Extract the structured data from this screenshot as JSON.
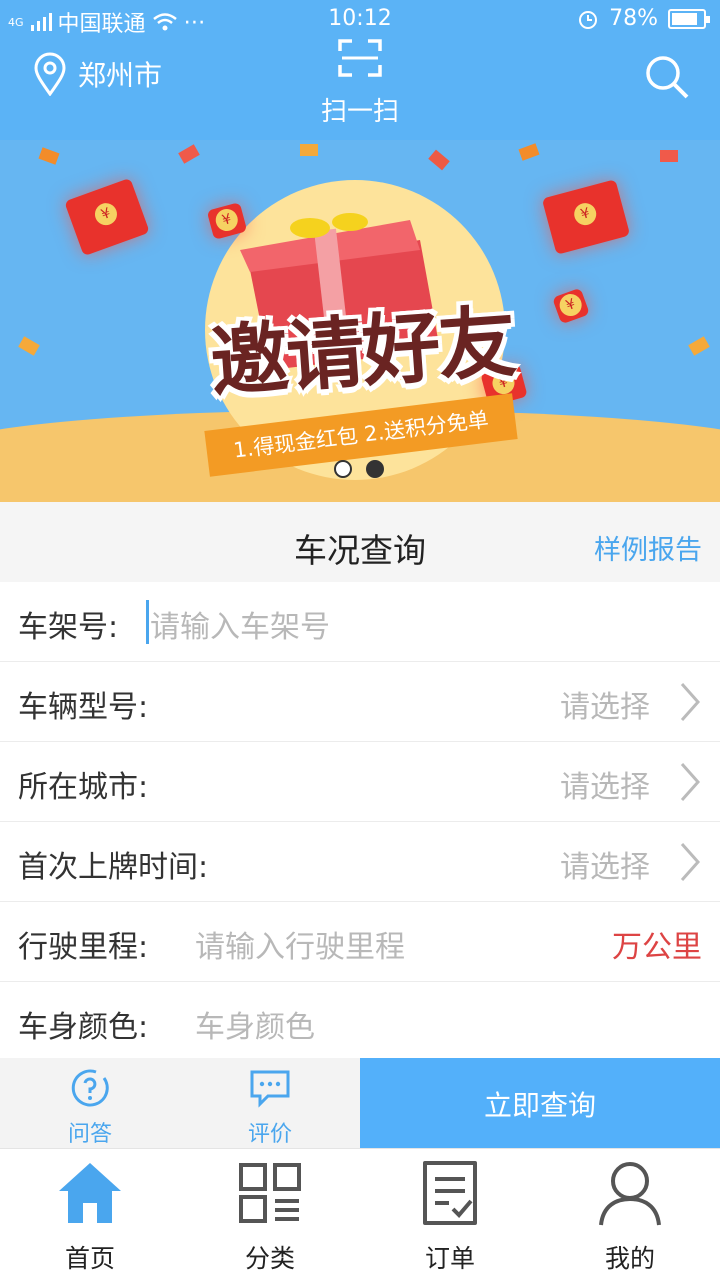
{
  "status_bar": {
    "carrier": "中国联通",
    "network": "4G",
    "time": "10:12",
    "battery": "78%",
    "battery_level": 0.78,
    "icons": [
      "signal-icon",
      "wifi-icon",
      "more-dots-icon",
      "alarm-icon",
      "battery-icon"
    ]
  },
  "header": {
    "city": "郑州市",
    "scan_label": "扫一扫",
    "icons": {
      "location": "location-pin-icon",
      "scan": "scan-icon",
      "search": "search-icon"
    }
  },
  "banner": {
    "title": "邀请好友",
    "subtitle": "1.得现金红包  2.送积分免单",
    "slide_count": 2,
    "active_slide": 1
  },
  "query": {
    "title": "车况查询",
    "sample_link": "样例报告",
    "fields": [
      {
        "label": "车架号:",
        "placeholder": "请输入车架号",
        "kind": "text"
      },
      {
        "label": "车辆型号:",
        "value": "请选择",
        "kind": "select"
      },
      {
        "label": "所在城市:",
        "value": "请选择",
        "kind": "select"
      },
      {
        "label": "首次上牌时间:",
        "value": "请选择",
        "kind": "select"
      },
      {
        "label": "行驶里程:",
        "placeholder": "请输入行驶里程",
        "unit": "万公里",
        "kind": "text"
      },
      {
        "label": "车身颜色:",
        "placeholder": "车身颜色",
        "kind": "text"
      }
    ]
  },
  "actions": {
    "qa_label": "问答",
    "review_label": "评价",
    "submit_label": "立即查询"
  },
  "tabbar": {
    "tabs": [
      {
        "label": "首页",
        "icon": "home-icon",
        "active": true
      },
      {
        "label": "分类",
        "icon": "category-grid-icon",
        "active": false
      },
      {
        "label": "订单",
        "icon": "order-icon",
        "active": false
      },
      {
        "label": "我的",
        "icon": "profile-icon",
        "active": false
      }
    ]
  },
  "colors": {
    "primary": "#5bb3f6",
    "accent_text": "#4aa6ee",
    "unit_red": "#d44444"
  }
}
